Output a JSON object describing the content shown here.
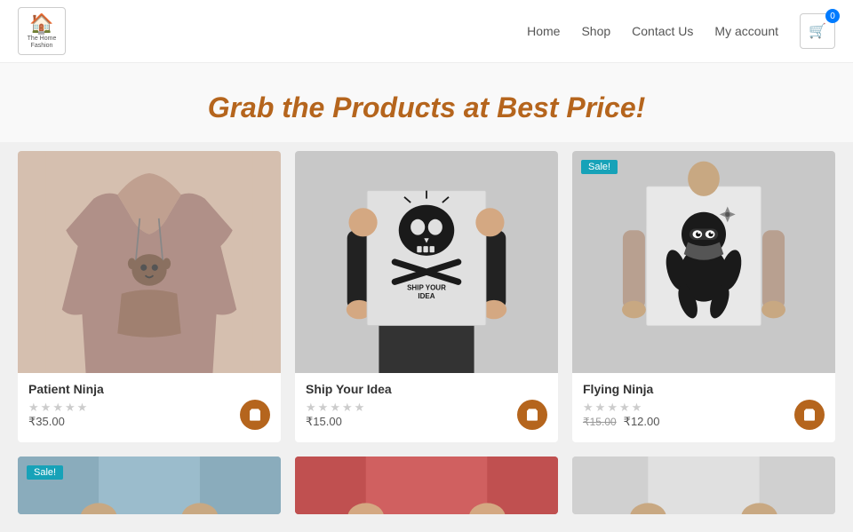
{
  "header": {
    "logo": {
      "icon": "🏠",
      "line1": "The Home",
      "line2": "Fashion"
    },
    "nav": {
      "home": "Home",
      "shop": "Shop",
      "contact": "Contact Us",
      "account": "My account"
    },
    "cart": {
      "badge": "0",
      "label": "Cart"
    }
  },
  "hero": {
    "title": "Grab the Products at Best Price!"
  },
  "products": [
    {
      "id": 1,
      "name": "Patient Ninja",
      "price": "₹35.00",
      "original_price": null,
      "sale": false,
      "stars": 0,
      "image_type": "hoodie"
    },
    {
      "id": 2,
      "name": "Ship Your Idea",
      "price": "₹15.00",
      "original_price": null,
      "sale": false,
      "stars": 0,
      "image_type": "poster-skull"
    },
    {
      "id": 3,
      "name": "Flying Ninja",
      "price": "₹12.00",
      "original_price": "₹15.00",
      "sale": true,
      "stars": 0,
      "image_type": "ninja"
    }
  ],
  "partial_products": [
    {
      "id": 4,
      "sale": true,
      "image_type": "partial-1"
    },
    {
      "id": 5,
      "sale": false,
      "image_type": "partial-2"
    },
    {
      "id": 6,
      "sale": false,
      "image_type": "partial-3"
    }
  ],
  "sale_label": "Sale!",
  "add_to_cart_label": "Add to cart"
}
